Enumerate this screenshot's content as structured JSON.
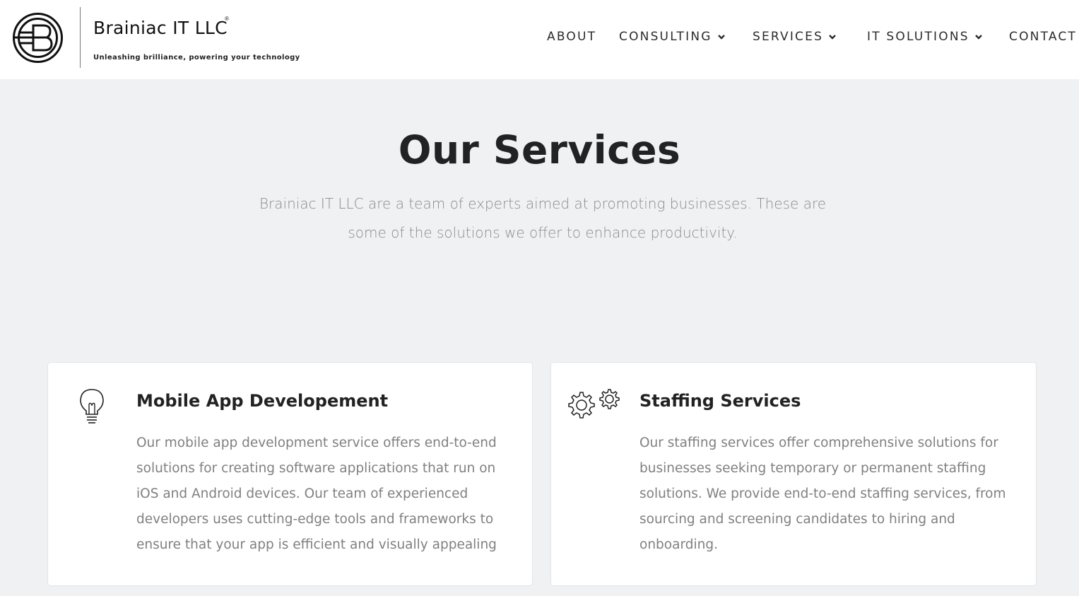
{
  "brand": {
    "name": "Brainiac IT LLC",
    "registered": "®",
    "tagline": "Unleashing brilliance, powering your technology"
  },
  "nav": {
    "about": "ABOUT",
    "consulting": "CONSULTING",
    "services": "SERVICES",
    "it_solutions": "IT SOLUTIONS",
    "contact": "CONTACT"
  },
  "hero": {
    "title": "Our Services",
    "subtitle": "Brainiac IT LLC are a team of experts aimed at promoting businesses. These are some of the solutions we offer to enhance productivity."
  },
  "services": [
    {
      "icon": "lightbulb-icon",
      "title": "Mobile App Developement",
      "description": "Our mobile app development service offers end-to-end solutions for creating software applications that run on iOS and Android devices. Our team of experienced developers uses cutting-edge tools and frameworks to ensure that your app is efficient and visually appealing"
    },
    {
      "icon": "gears-icon",
      "title": "Staffing Services",
      "description": "Our staffing services offer comprehensive solutions for businesses seeking temporary or permanent staffing solutions. We provide end-to-end staffing services, from sourcing and screening candidates to hiring and onboarding."
    }
  ],
  "colors": {
    "page_background": "#f0f1f3",
    "header_background": "#ffffff",
    "heading_text": "#222222",
    "muted_text": "#808080"
  }
}
